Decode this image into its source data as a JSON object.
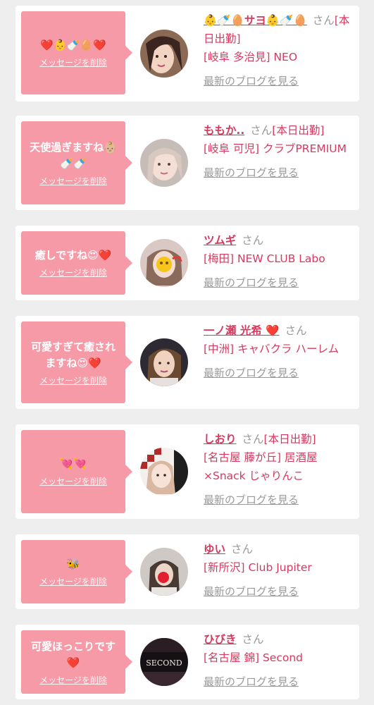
{
  "del_label": "メッセージを削除",
  "san_label": "さん",
  "blog_label": "最新のブログを見る",
  "colors": {
    "accent": "#d6395f",
    "bubble": "#f79aa8",
    "muted": "#999999",
    "background": "#eeeeee"
  },
  "cards": [
    {
      "message": "❤️👶🍼🥚❤️",
      "name": "👶🍼🥚サヨ👶🍼🥚",
      "status": "[本日出勤]",
      "shop": "[岐阜 多治見] NEO",
      "avatar": "avatar-1"
    },
    {
      "message": "天使過ぎますね👶🏼\n🍼🍼",
      "name": "ももか..",
      "status": "[本日出勤]",
      "shop": "[岐阜 可児] クラブPREMIUM",
      "avatar": "avatar-2"
    },
    {
      "message": "癒しですね😍❤️",
      "name": "ツムギ",
      "status": "",
      "shop": "[梅田] NEW CLUB Labo",
      "avatar": "avatar-3"
    },
    {
      "message": "可愛すぎて癒され\nますね😍❤️",
      "name": "一ノ瀬 光希 ❤️",
      "status": "",
      "shop": "[中洲] キャバクラ ハーレム",
      "avatar": "avatar-4"
    },
    {
      "message": "💘💘",
      "name": "しおり",
      "status": "[本日出勤]",
      "shop": "[名古屋 藤が丘] 居酒屋×Snack じゃりんこ",
      "avatar": "avatar-5"
    },
    {
      "message": "🐝",
      "name": "ゆい",
      "status": "",
      "shop": "[新所沢] Club Jupiter",
      "avatar": "avatar-6"
    },
    {
      "message": "可愛ほっこりです\n❤️",
      "name": "ひびき",
      "status": "",
      "shop": "[名古屋 錦] Second",
      "avatar": "avatar-7",
      "avatar_text": "SECOND"
    }
  ]
}
